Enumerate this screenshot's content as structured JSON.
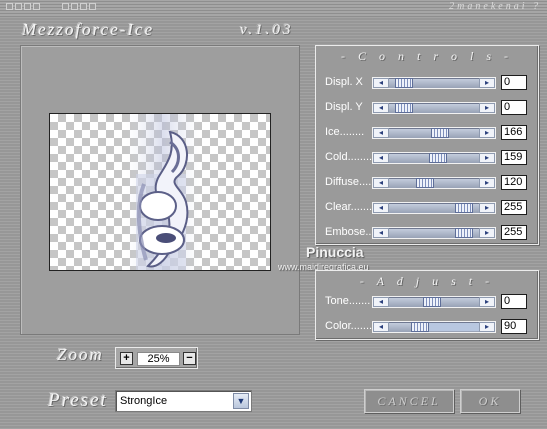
{
  "titlebar": {
    "brand": "2manekenai ?"
  },
  "header": {
    "title": "Mezzoforce-Ice",
    "version": "v.1.03"
  },
  "watermark": {
    "name": "Pinuccia",
    "url": "www.maidiregrafica.eu"
  },
  "controls": {
    "title": "- C o n t r o l s -",
    "sliders": [
      {
        "label": "Displ. X",
        "value": "0",
        "level": 0.08
      },
      {
        "label": "Displ. Y",
        "value": "0",
        "level": 0.08
      },
      {
        "label": "Ice........",
        "value": "166",
        "level": 0.58
      },
      {
        "label": "Cold.........",
        "value": "159",
        "level": 0.55
      },
      {
        "label": "Diffuse......",
        "value": "120",
        "level": 0.38
      },
      {
        "label": "Clear.......",
        "value": "255",
        "level": 0.92
      },
      {
        "label": "Embose......",
        "value": "255",
        "level": 0.92
      }
    ]
  },
  "adjust": {
    "title": "- A d j u s t -",
    "sliders": [
      {
        "label": "Tone.......",
        "value": "0",
        "level": 0.47
      },
      {
        "label": "Color.......",
        "value": "90",
        "level": 0.3
      }
    ]
  },
  "zoom": {
    "label": "Zoom",
    "value": "25%",
    "plus": "+",
    "minus": "−"
  },
  "preset": {
    "label": "Preset",
    "selected": "StrongIce"
  },
  "buttons": {
    "cancel": "CANCEL",
    "ok": "OK"
  },
  "colors": {
    "background": "#9c9c9c",
    "track": "#98a2b6",
    "thumb": "#7f8fbb",
    "text": "#ffffff"
  }
}
